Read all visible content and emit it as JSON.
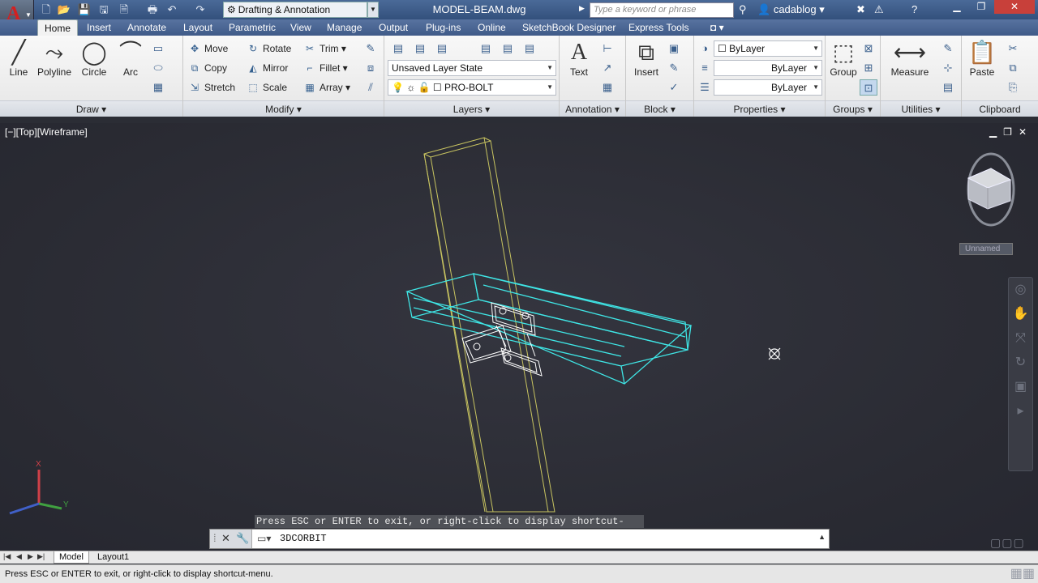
{
  "titlebar": {
    "workspace": "Drafting & Annotation",
    "document": "MODEL-BEAM.dwg",
    "search_placeholder": "Type a keyword or phrase",
    "user": "cadablog"
  },
  "tabs": [
    "Home",
    "Insert",
    "Annotate",
    "Layout",
    "Parametric",
    "View",
    "Manage",
    "Output",
    "Plug-ins",
    "Online",
    "SketchBook Designer",
    "Express Tools"
  ],
  "ribbon": {
    "draw": {
      "title": "Draw",
      "line": "Line",
      "polyline": "Polyline",
      "circle": "Circle",
      "arc": "Arc"
    },
    "modify": {
      "title": "Modify",
      "move": "Move",
      "rotate": "Rotate",
      "trim": "Trim",
      "copy": "Copy",
      "mirror": "Mirror",
      "fillet": "Fillet",
      "stretch": "Stretch",
      "scale": "Scale",
      "array": "Array"
    },
    "layers": {
      "title": "Layers",
      "layer_state": "Unsaved Layer State",
      "current_layer": "PRO-BOLT"
    },
    "annotation": {
      "title": "Annotation",
      "text": "Text"
    },
    "block": {
      "title": "Block",
      "insert": "Insert"
    },
    "properties": {
      "title": "Properties",
      "color": "ByLayer",
      "linetype": "ByLayer",
      "lineweight": "ByLayer"
    },
    "groups": {
      "title": "Groups",
      "group": "Group"
    },
    "utilities": {
      "title": "Utilities",
      "measure": "Measure"
    },
    "clipboard": {
      "title": "Clipboard",
      "paste": "Paste"
    }
  },
  "viewport": {
    "label": "[−][Top][Wireframe]",
    "viewcube_label": "Unnamed"
  },
  "command": {
    "hint": "Press ESC or ENTER to exit, or right-click to display shortcut-menu.",
    "current": "3DCORBIT"
  },
  "layout_tabs": [
    "Model",
    "Layout1"
  ],
  "status": "Press ESC or ENTER to exit, or right-click to display shortcut-menu.",
  "colors": {
    "wire_cyan": "#3fe6e6",
    "wire_yellow": "#c8c460",
    "wire_white": "#ffffff",
    "title_blue": "#3f5a88"
  }
}
